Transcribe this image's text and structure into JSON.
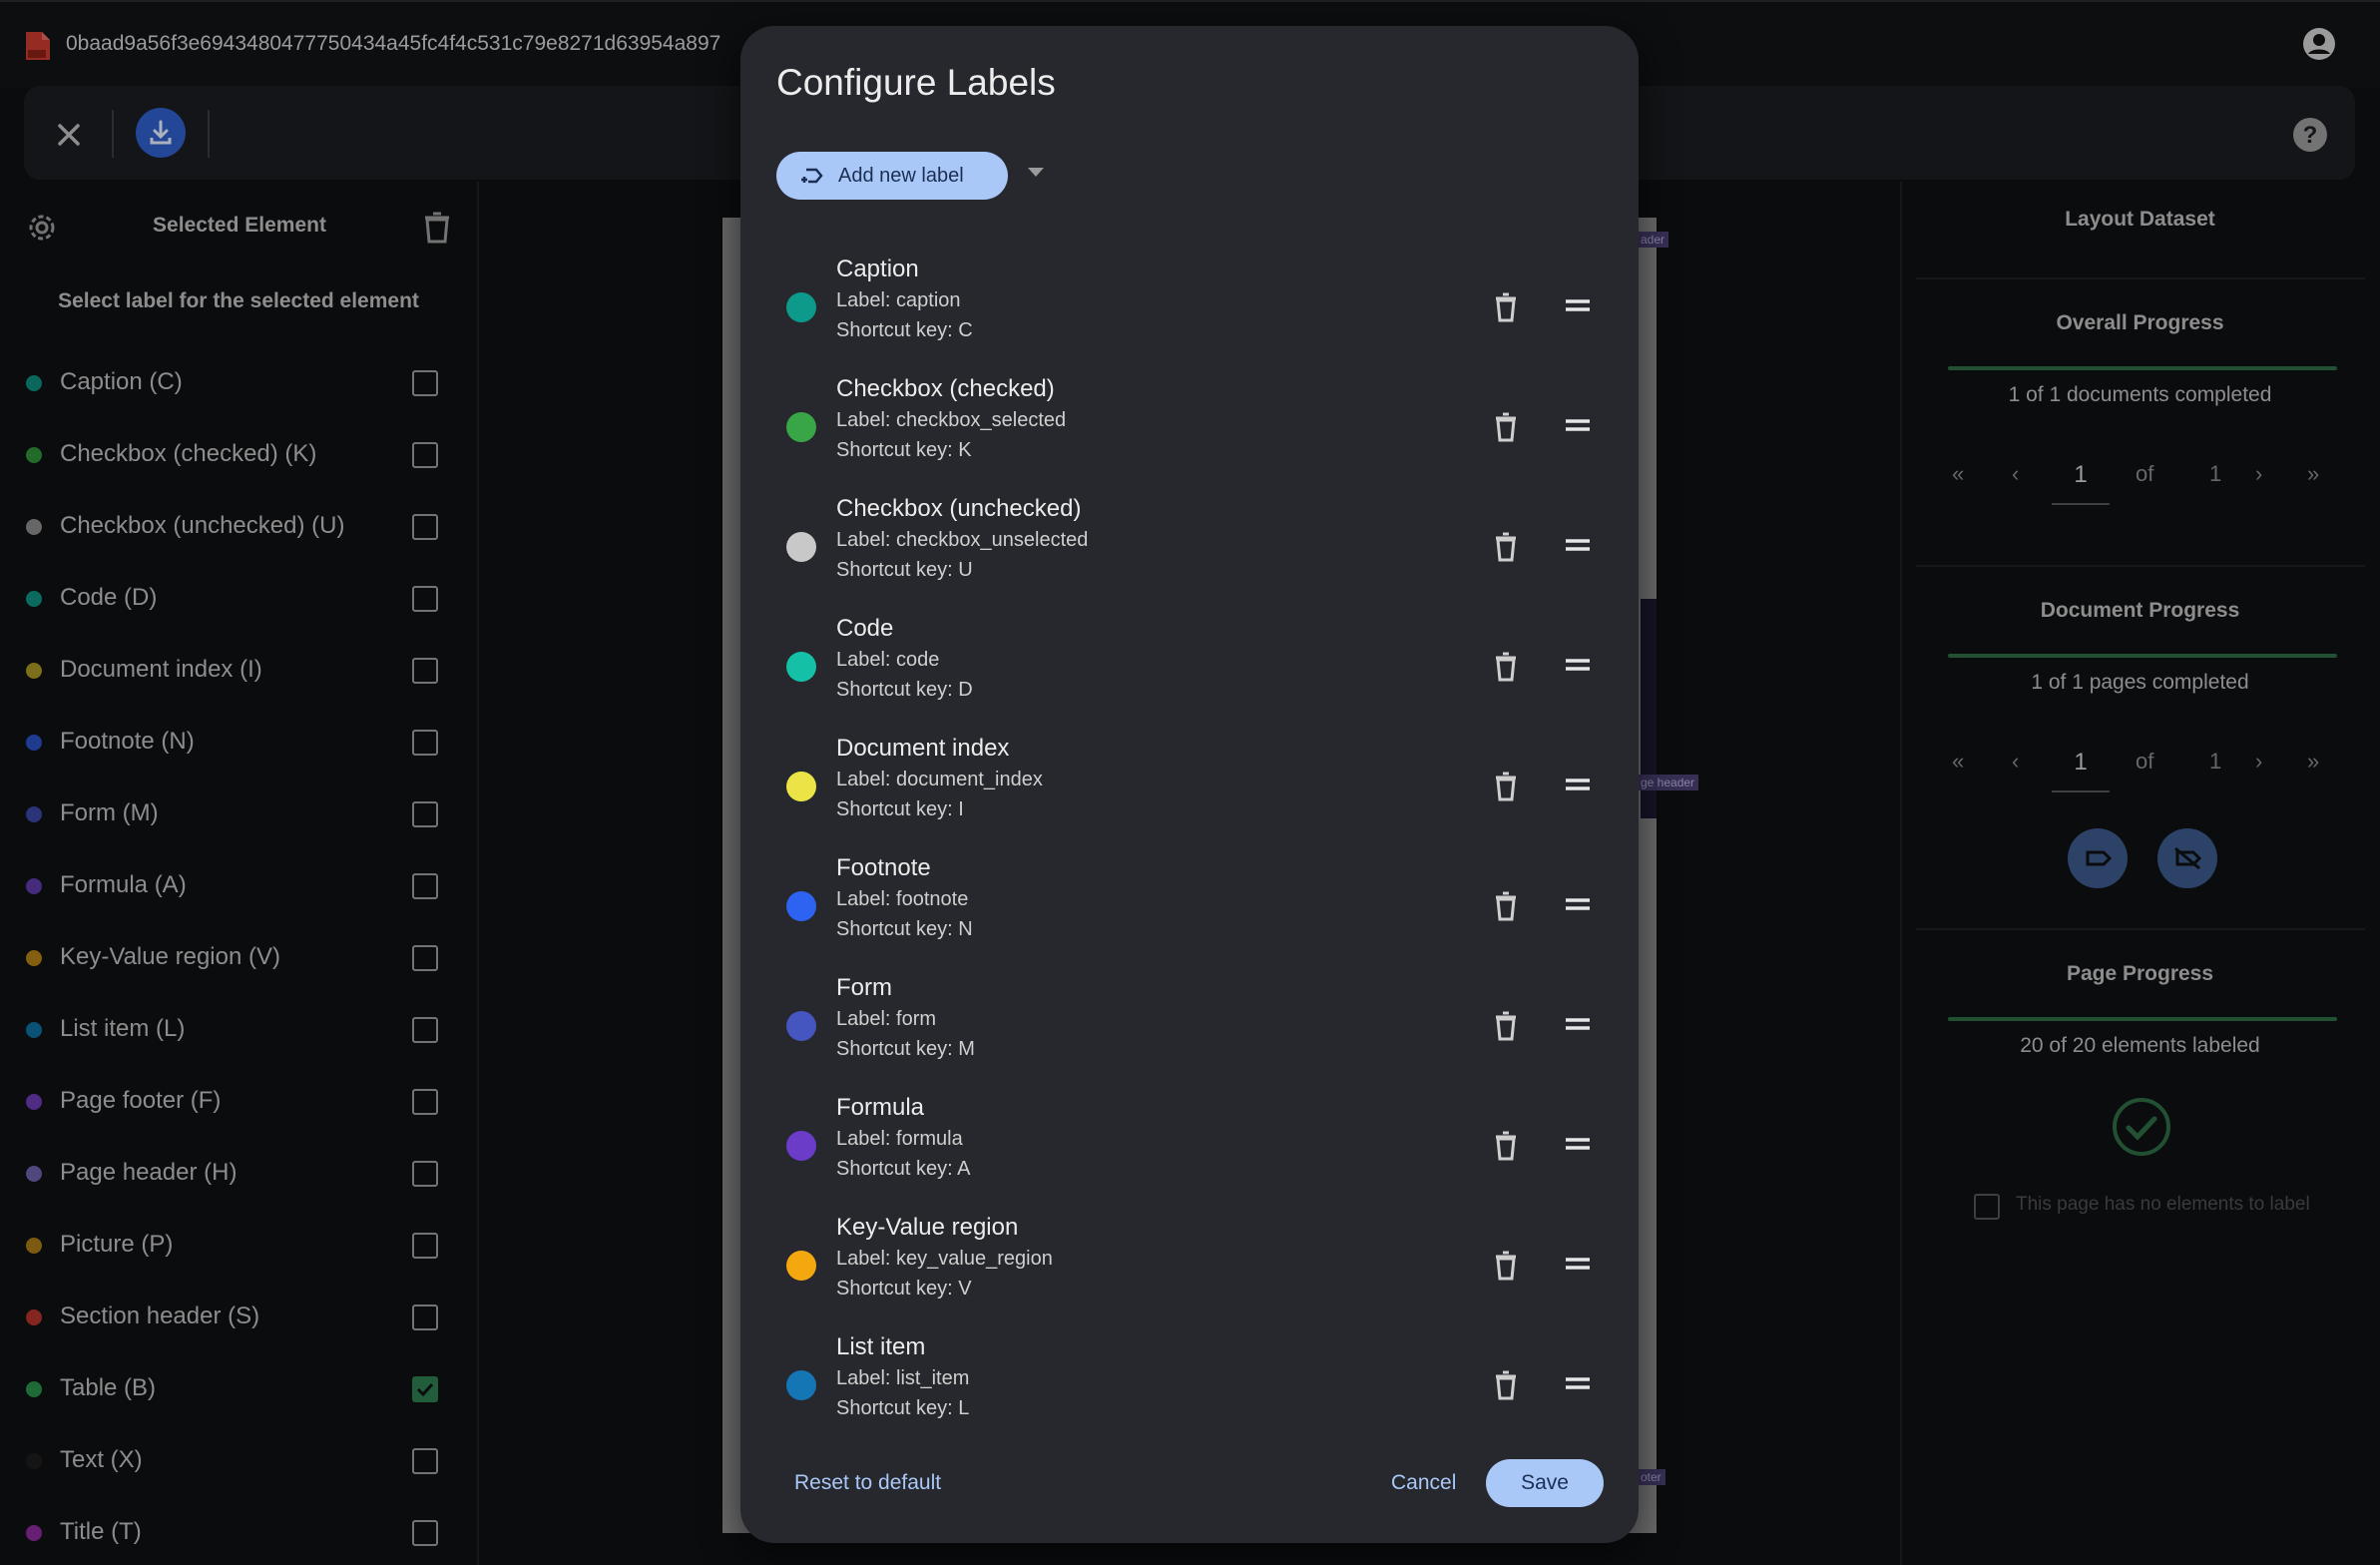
{
  "topbar": {
    "doc_title": "0baad9a56f3e6943480477750434a45fc4f4c531c79e8271d63954a897"
  },
  "sidebar": {
    "title": "Selected Element",
    "subtitle": "Select label for the selected element",
    "labels": [
      {
        "text": "Caption (C)",
        "color": "#0e8a7a",
        "checked": false
      },
      {
        "text": "Checkbox (checked) (K)",
        "color": "#2f8f3a",
        "checked": false
      },
      {
        "text": "Checkbox (unchecked) (U)",
        "color": "#8a8a8a",
        "checked": false
      },
      {
        "text": "Code (D)",
        "color": "#0e8f7f",
        "checked": false
      },
      {
        "text": "Document index (I)",
        "color": "#a59422",
        "checked": false
      },
      {
        "text": "Footnote (N)",
        "color": "#2a4fbf",
        "checked": false
      },
      {
        "text": "Form (M)",
        "color": "#3a46a0",
        "checked": false
      },
      {
        "text": "Formula (A)",
        "color": "#5b3aa8",
        "checked": false
      },
      {
        "text": "Key-Value region (V)",
        "color": "#b07f14",
        "checked": false
      },
      {
        "text": "List item (L)",
        "color": "#0d6e9c",
        "checked": false
      },
      {
        "text": "Page footer (F)",
        "color": "#6a3ab0",
        "checked": false
      },
      {
        "text": "Page header (H)",
        "color": "#6b5fa8",
        "checked": false
      },
      {
        "text": "Picture (P)",
        "color": "#a47a14",
        "checked": false
      },
      {
        "text": "Section header (S)",
        "color": "#b0332a",
        "checked": false
      },
      {
        "text": "Table (B)",
        "color": "#2a8f4a",
        "checked": true
      },
      {
        "text": "Text (X)",
        "color": "#1d1d1d",
        "checked": false
      },
      {
        "text": "Title (T)",
        "color": "#8a2a9a",
        "checked": false
      }
    ]
  },
  "right_panel": {
    "title": "Layout Dataset",
    "overall": {
      "heading": "Overall Progress",
      "status": "1 of 1 documents completed",
      "page": "1",
      "of": "of",
      "total": "1"
    },
    "document": {
      "heading": "Document Progress",
      "status": "1 of 1 pages completed",
      "page": "1",
      "of": "of",
      "total": "1"
    },
    "page": {
      "heading": "Page Progress",
      "status": "20 of 20 elements labeled",
      "no_elements_text": "This page has no elements to label"
    }
  },
  "doc_tags": {
    "tag1": "ader",
    "tag2": "ge header",
    "tag3": "oter"
  },
  "dialog": {
    "title": "Configure Labels",
    "add_button": "Add new label",
    "items": [
      {
        "name": "Caption",
        "label": "Label: caption",
        "key": "Shortcut key: C",
        "color": "#0e9a8a"
      },
      {
        "name": "Checkbox (checked)",
        "label": "Label: checkbox_selected",
        "key": "Shortcut key: K",
        "color": "#38a547"
      },
      {
        "name": "Checkbox (unchecked)",
        "label": "Label: checkbox_unselected",
        "key": "Shortcut key: U",
        "color": "#c8c8c8"
      },
      {
        "name": "Code",
        "label": "Label: code",
        "key": "Shortcut key: D",
        "color": "#14c0a6"
      },
      {
        "name": "Document index",
        "label": "Label: document_index",
        "key": "Shortcut key: I",
        "color": "#ece447"
      },
      {
        "name": "Footnote",
        "label": "Label: footnote",
        "key": "Shortcut key: N",
        "color": "#2d63f0"
      },
      {
        "name": "Form",
        "label": "Label: form",
        "key": "Shortcut key: M",
        "color": "#4656c0"
      },
      {
        "name": "Formula",
        "label": "Label: formula",
        "key": "Shortcut key: A",
        "color": "#6a3cc8"
      },
      {
        "name": "Key-Value region",
        "label": "Label: key_value_region",
        "key": "Shortcut key: V",
        "color": "#f4a70f"
      },
      {
        "name": "List item",
        "label": "Label: list_item",
        "key": "Shortcut key: L",
        "color": "#1576b5"
      }
    ],
    "reset": "Reset to default",
    "cancel": "Cancel",
    "save": "Save"
  }
}
